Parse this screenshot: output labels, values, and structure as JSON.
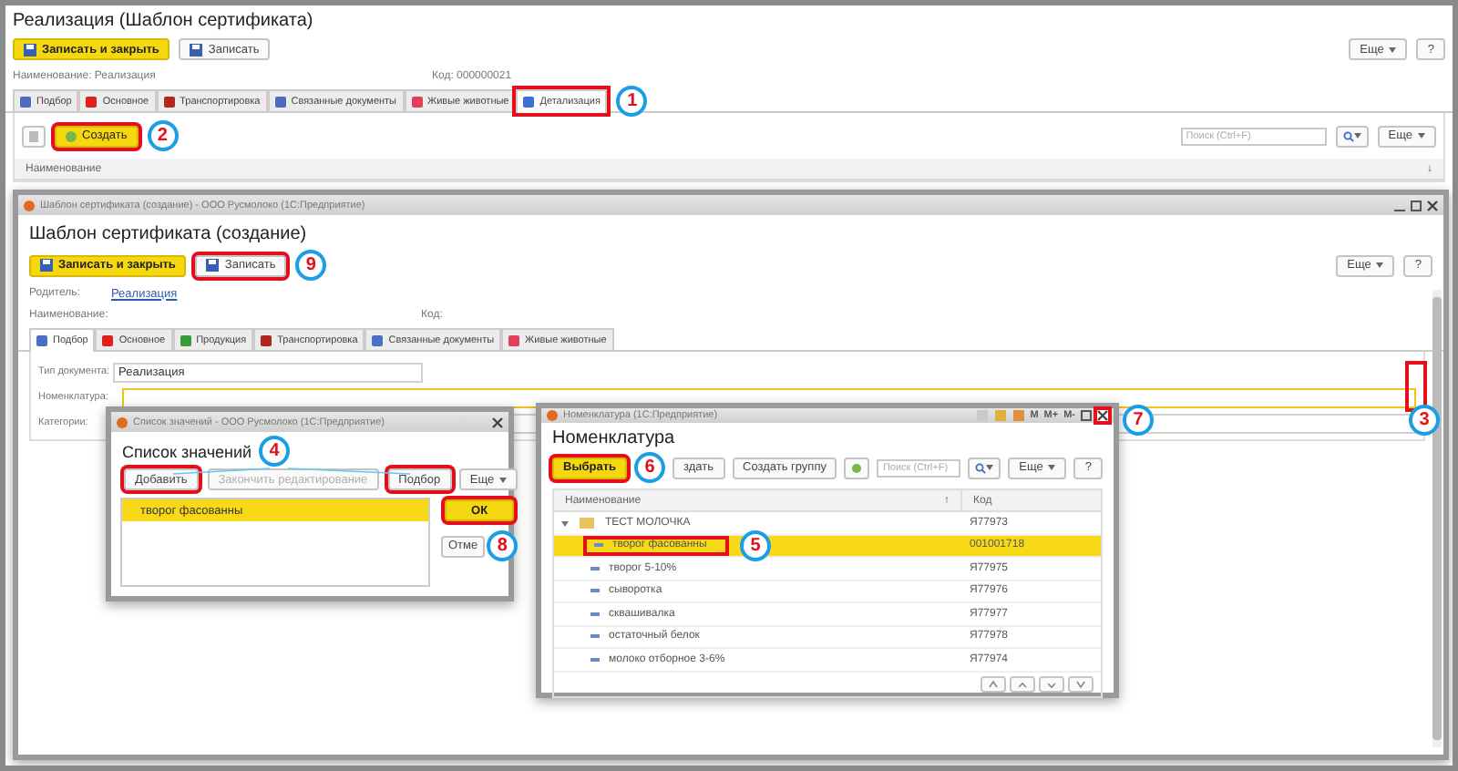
{
  "main": {
    "title": "Реализация (Шаблон сертификата)",
    "toolbar": [
      {
        "label": "Записать и закрыть",
        "kind": "primary"
      },
      {
        "label": "Записать",
        "kind": "default"
      }
    ],
    "more": "Еще",
    "help": "?",
    "name_label": "Наименование: Реализация",
    "code_label": "Код: 000000021",
    "tabs": [
      {
        "label": "Подбор",
        "selected": false,
        "highlighted": false
      },
      {
        "label": "Основное",
        "selected": false,
        "highlighted": false
      },
      {
        "label": "Транспортировка",
        "selected": false,
        "highlighted": false
      },
      {
        "label": "Связанные документы",
        "selected": false,
        "highlighted": false
      },
      {
        "label": "Живые животные",
        "selected": false,
        "highlighted": false
      },
      {
        "label": "Детализация",
        "selected": true,
        "highlighted": true
      }
    ],
    "create": {
      "label": "Создать",
      "highlighted": true
    },
    "search_placeholder": "Поиск (Ctrl+F)",
    "list_more": "Еще",
    "column": "Наименование",
    "sort_mark": "↓"
  },
  "form": {
    "window_title": "Шаблон сертификата (создание) - ООО Русмолоко   (1С:Предприятие)",
    "title": "Шаблон сертификата (создание)",
    "toolbar": [
      {
        "label": "Записать и закрыть",
        "kind": "primary",
        "highlighted": false
      },
      {
        "label": "Записать",
        "kind": "default",
        "highlighted": true
      }
    ],
    "more": "Еще",
    "help": "?",
    "parent_label": "Родитель:",
    "parent_link": "Реализация",
    "name_label": "Наименование:",
    "code_label": "Код:",
    "tabs": [
      {
        "label": "Подбор",
        "selected": true
      },
      {
        "label": "Основное",
        "selected": false
      },
      {
        "label": "Продукция",
        "selected": false
      },
      {
        "label": "Транспортировка",
        "selected": false
      },
      {
        "label": "Связанные документы",
        "selected": false
      },
      {
        "label": "Живые животные",
        "selected": false
      }
    ],
    "fields": [
      {
        "label": "Тип документа:",
        "value": "Реализация",
        "focused": false,
        "wide": false
      },
      {
        "label": "Номенклатура:",
        "focused": true,
        "wide": true
      },
      {
        "label": "Категории:",
        "focused": false,
        "wide": true
      }
    ],
    "field_buttons_highlighted": true
  },
  "values_dialog": {
    "window_title": "Список значений - ООО Русмолоко   (1С:Предприятие)",
    "title": "Список значений",
    "buttons": [
      {
        "label": "Добавить",
        "disabled": false,
        "highlighted": true
      },
      {
        "label": "Закончить редактирование",
        "disabled": true,
        "highlighted": false
      },
      {
        "label": "Подбор",
        "disabled": false,
        "highlighted": true
      }
    ],
    "more": "Еще",
    "ok": {
      "label": "ОК",
      "highlighted": true
    },
    "cancel": "Отме",
    "items": [
      {
        "text": "творог фасованны",
        "selected": true
      }
    ]
  },
  "catalog_dialog": {
    "window_title": "Номенклатура  (1С:Предприятие)",
    "title_buttons": [
      "M",
      "M+",
      "M-"
    ],
    "close_highlighted": true,
    "title": "Номенклатура",
    "toolbar": [
      {
        "label": "Выбрать",
        "kind": "primary",
        "highlighted": true
      },
      {
        "label": "здать",
        "kind": "default",
        "highlighted": false
      },
      {
        "label": "Создать группу",
        "kind": "default",
        "highlighted": false
      }
    ],
    "search_placeholder": "Поиск (Ctrl+F)",
    "more": "Еще",
    "help": "?",
    "columns": [
      {
        "label": "Наименование",
        "sort": "↑"
      },
      {
        "label": "Код"
      }
    ],
    "rows": [
      {
        "name": "ТЕСТ МОЛОЧКА",
        "code": "Я77973",
        "expanded": true,
        "selected": false,
        "children": [
          {
            "name": "творог фасованны",
            "code": "001001718",
            "selected": true,
            "highlighted": true
          },
          {
            "name": "творог 5-10%",
            "code": "Я77975",
            "selected": false,
            "highlighted": false
          },
          {
            "name": "сыворотка",
            "code": "Я77976",
            "selected": false,
            "highlighted": false
          },
          {
            "name": "сквашивалка",
            "code": "Я77977",
            "selected": false,
            "highlighted": false
          },
          {
            "name": "остаточный белок",
            "code": "Я77978",
            "selected": false,
            "highlighted": false
          },
          {
            "name": "молоко отборное 3-6%",
            "code": "Я77974",
            "selected": false,
            "highlighted": false
          }
        ]
      }
    ]
  },
  "annotations": [
    {
      "number": "1"
    },
    {
      "number": "2"
    },
    {
      "number": "3"
    },
    {
      "number": "4"
    },
    {
      "number": "5"
    },
    {
      "number": "6"
    },
    {
      "number": "7"
    },
    {
      "number": "8"
    },
    {
      "number": "9"
    }
  ]
}
